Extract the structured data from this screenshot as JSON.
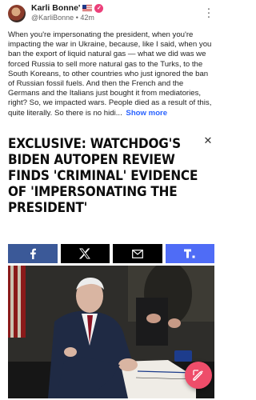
{
  "post": {
    "author": "Karli Bonne'",
    "handle": "@KarliBonne",
    "separator": "•",
    "time": "42m",
    "flag_icon": "us-flag-icon",
    "verified_icon": "verified-badge-icon",
    "text": "When you're impersonating the president, when you're impacting the war in Ukraine, because, like I said, when you ban the export of liquid natural gas — what we did was we forced Russia to sell more natural gas to the Turks, to the South Koreans, to other countries who just ignored the ban of Russian fossil fuels. And then the French and the Germans and the Italians just bought it from mediatories, right? So, we impacted wars. People died as a result of this, quite literally. So there is no hidi...",
    "show_more": "Show more"
  },
  "article": {
    "headline_lines": [
      "EXCLUSIVE: WATCHDOG'S",
      "BIDEN AUTOPEN REVIEW",
      "FINDS 'CRIMINAL' EVIDENCE",
      "OF 'IMPERSONATING THE",
      "PRESIDENT'"
    ],
    "close_icon": "close-icon",
    "share_buttons": [
      {
        "icon": "facebook-icon",
        "color": "#3b5998"
      },
      {
        "icon": "x-icon",
        "color": "#000000"
      },
      {
        "icon": "email-icon",
        "color": "#000000"
      },
      {
        "icon": "truth-social-icon",
        "color": "#4f6cf6"
      }
    ]
  },
  "fab": {
    "icon": "compose-icon",
    "color": "#ee4d6a"
  }
}
